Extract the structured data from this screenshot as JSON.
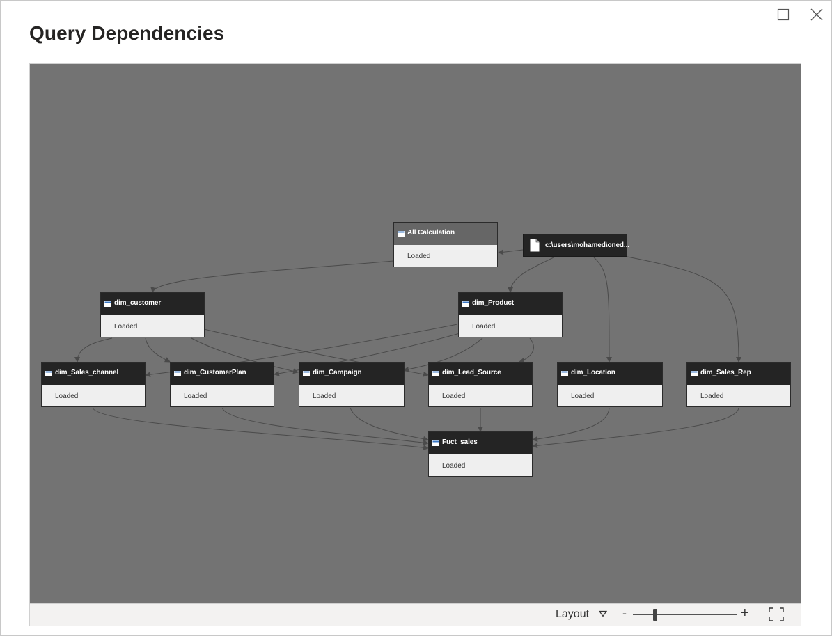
{
  "dialog": {
    "title": "Query Dependencies",
    "maximize_icon": "maximize-icon",
    "close_icon": "close-icon"
  },
  "graph": {
    "background": "#737373",
    "node_header_color": "#242424",
    "node_header_selected_color": "#666666",
    "node_body_color": "#efefef",
    "edge_color": "#4a4a4a",
    "nodes": [
      {
        "id": "all_calc",
        "name": "All Calculation",
        "status": "Loaded",
        "icon": "table-icon"
      },
      {
        "id": "source",
        "name": "c:\\users\\mohamed\\oned...",
        "icon": "document-icon"
      },
      {
        "id": "dim_customer",
        "name": "dim_customer",
        "status": "Loaded",
        "icon": "table-icon"
      },
      {
        "id": "dim_product",
        "name": "dim_Product",
        "status": "Loaded",
        "icon": "table-icon"
      },
      {
        "id": "dim_sales_channel",
        "name": "dim_Sales_channel",
        "status": "Loaded",
        "icon": "table-icon"
      },
      {
        "id": "dim_customerplan",
        "name": "dim_CustomerPlan",
        "status": "Loaded",
        "icon": "table-icon"
      },
      {
        "id": "dim_campaign",
        "name": "dim_Campaign",
        "status": "Loaded",
        "icon": "table-icon"
      },
      {
        "id": "dim_lead_source",
        "name": "dim_Lead_Source",
        "status": "Loaded",
        "icon": "table-icon"
      },
      {
        "id": "dim_location",
        "name": "dim_Location",
        "status": "Loaded",
        "icon": "table-icon"
      },
      {
        "id": "dim_sales_rep",
        "name": "dim_Sales_Rep",
        "status": "Loaded",
        "icon": "table-icon"
      },
      {
        "id": "fuct_sales",
        "name": "Fuct_sales",
        "status": "Loaded",
        "icon": "table-icon"
      }
    ]
  },
  "toolbar": {
    "layout_label": "Layout",
    "layout_caret_icon": "chevron-down-icon",
    "zoom_out_label": "-",
    "zoom_in_label": "+",
    "zoom_level": 0.2,
    "fit_icon": "fit-to-screen-icon"
  }
}
